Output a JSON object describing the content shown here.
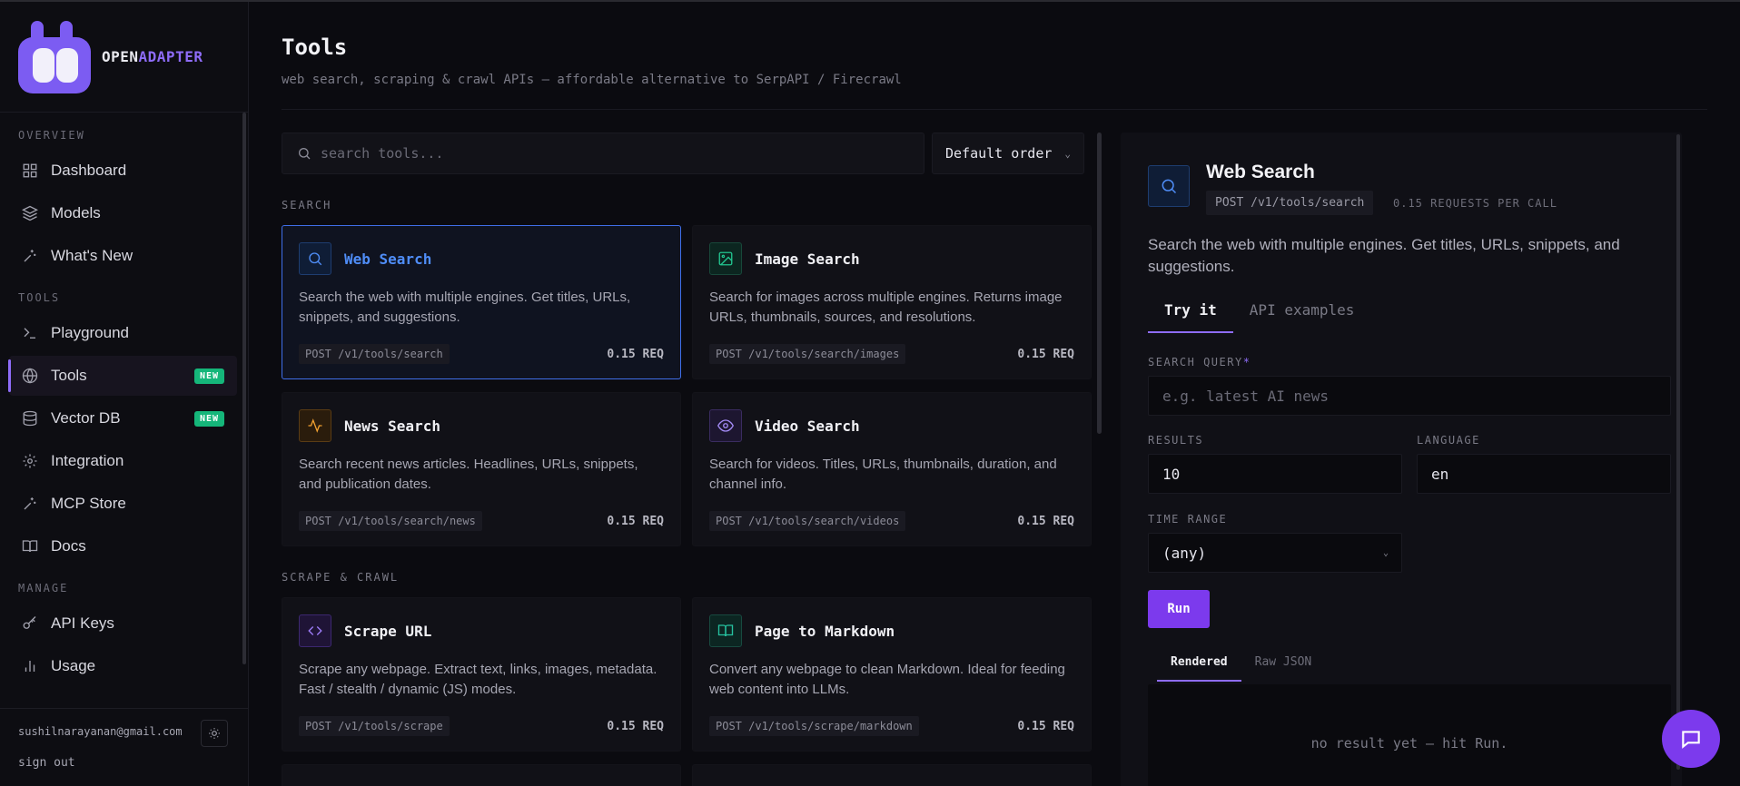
{
  "brand": {
    "name_a": "OPEN",
    "name_b": "ADAPTER"
  },
  "sidebar": {
    "sections": [
      {
        "label": "OVERVIEW",
        "items": [
          {
            "label": "Dashboard",
            "icon": "grid-icon"
          },
          {
            "label": "Models",
            "icon": "layers-icon"
          },
          {
            "label": "What's New",
            "icon": "sparkle-icon"
          }
        ]
      },
      {
        "label": "TOOLS",
        "items": [
          {
            "label": "Playground",
            "icon": "terminal-icon"
          },
          {
            "label": "Tools",
            "icon": "globe-icon",
            "badge": "NEW",
            "active": true
          },
          {
            "label": "Vector DB",
            "icon": "database-icon",
            "badge": "NEW"
          },
          {
            "label": "Integration",
            "icon": "gear-icon"
          },
          {
            "label": "MCP Store",
            "icon": "sparkle-icon"
          },
          {
            "label": "Docs",
            "icon": "book-icon"
          }
        ]
      },
      {
        "label": "MANAGE",
        "items": [
          {
            "label": "API Keys",
            "icon": "key-icon"
          },
          {
            "label": "Usage",
            "icon": "bar-chart-icon"
          }
        ]
      }
    ],
    "user_email": "sushilnarayanan@gmail.com",
    "sign_out": "sign out"
  },
  "page": {
    "title": "Tools",
    "subtitle": "web search, scraping & crawl APIs — affordable alternative to SerpAPI / Firecrawl",
    "search_placeholder": "search tools...",
    "order": "Default order"
  },
  "groups": [
    {
      "label": "SEARCH",
      "cards": [
        {
          "title": "Web Search",
          "desc": "Search the web with multiple engines. Get titles, URLs, snippets, and suggestions.",
          "endpoint": "POST /v1/tools/search",
          "price": "0.15 REQ",
          "icon": "search-icon",
          "selected": true
        },
        {
          "title": "Image Search",
          "desc": "Search for images across multiple engines. Returns image URLs, thumbnails, sources, and resolutions.",
          "endpoint": "POST /v1/tools/search/images",
          "price": "0.15 REQ",
          "icon": "image-icon"
        },
        {
          "title": "News Search",
          "desc": "Search recent news articles. Headlines, URLs, snippets, and publication dates.",
          "endpoint": "POST /v1/tools/search/news",
          "price": "0.15 REQ",
          "icon": "activity-icon"
        },
        {
          "title": "Video Search",
          "desc": "Search for videos. Titles, URLs, thumbnails, duration, and channel info.",
          "endpoint": "POST /v1/tools/search/videos",
          "price": "0.15 REQ",
          "icon": "eye-icon"
        }
      ]
    },
    {
      "label": "SCRAPE & CRAWL",
      "cards": [
        {
          "title": "Scrape URL",
          "desc": "Scrape any webpage. Extract text, links, images, metadata. Fast / stealth / dynamic (JS) modes.",
          "endpoint": "POST /v1/tools/scrape",
          "price": "0.15 REQ",
          "icon": "code-icon"
        },
        {
          "title": "Page to Markdown",
          "desc": "Convert any webpage to clean Markdown. Ideal for feeding web content into LLMs.",
          "endpoint": "POST /v1/tools/scrape/markdown",
          "price": "0.15 REQ",
          "icon": "book-open-icon"
        }
      ]
    }
  ],
  "detail": {
    "title": "Web Search",
    "endpoint": "POST /v1/tools/search",
    "rate": "0.15 REQUESTS PER CALL",
    "desc": "Search the web with multiple engines. Get titles, URLs, snippets, and suggestions.",
    "tabs": [
      "Try it",
      "API examples"
    ],
    "query_label": "SEARCH QUERY",
    "query_required": "*",
    "query_placeholder": "e.g. latest AI news",
    "results_label": "RESULTS",
    "results_value": "10",
    "language_label": "LANGUAGE",
    "language_value": "en",
    "time_label": "TIME RANGE",
    "time_value": "(any)",
    "run_label": "Run",
    "result_tabs": [
      "Rendered",
      "Raw JSON"
    ],
    "empty_result": "no result yet — hit Run."
  }
}
